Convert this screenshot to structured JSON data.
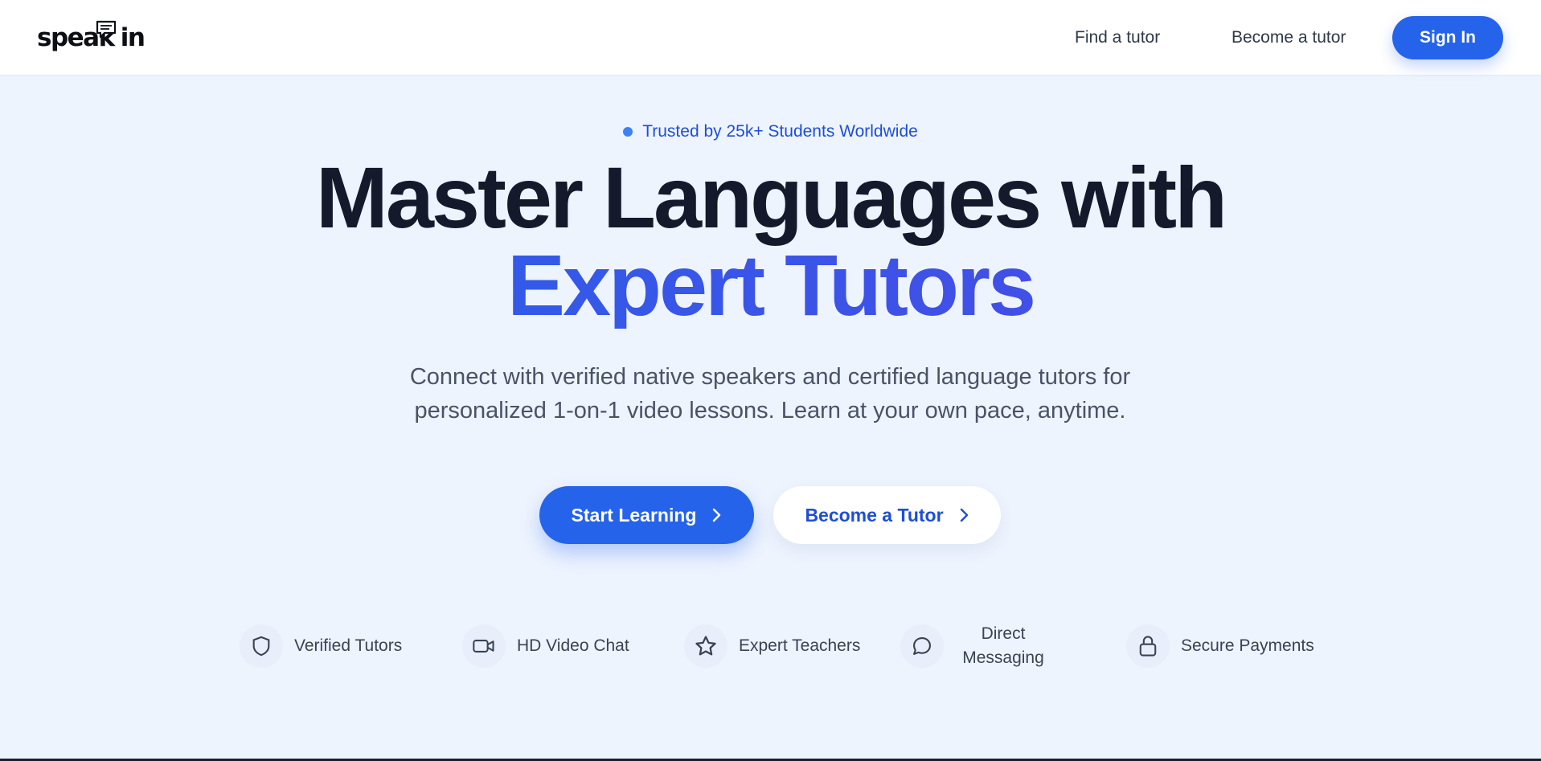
{
  "nav": {
    "logo_text_left": "speak",
    "logo_text_right": "in",
    "find_tutor": "Find a tutor",
    "become_tutor": "Become a tutor",
    "sign_in": "Sign In"
  },
  "hero": {
    "badge": "Trusted by 25k+ Students Worldwide",
    "title_line1": "Master Languages with",
    "title_line2": "Expert Tutors",
    "subtitle_line1": "Connect with verified native speakers and certified language tutors for",
    "subtitle_line2": "personalized 1-on-1 video lessons. Learn at your own pace, anytime.",
    "cta_primary": "Start Learning",
    "cta_secondary": "Become a Tutor"
  },
  "features": [
    {
      "label": "Verified Tutors",
      "icon": "shield-icon"
    },
    {
      "label": "HD Video Chat",
      "icon": "video-camera-icon"
    },
    {
      "label": "Expert Teachers",
      "icon": "star-icon"
    },
    {
      "label": "Direct Messaging",
      "icon": "chat-bubble-icon"
    },
    {
      "label": "Secure Payments",
      "icon": "lock-icon"
    }
  ],
  "colors": {
    "accent": "#2563eb",
    "accent_gradient_end": "#4f46e5",
    "heading": "#141a2b",
    "background": "#eef4fe"
  }
}
